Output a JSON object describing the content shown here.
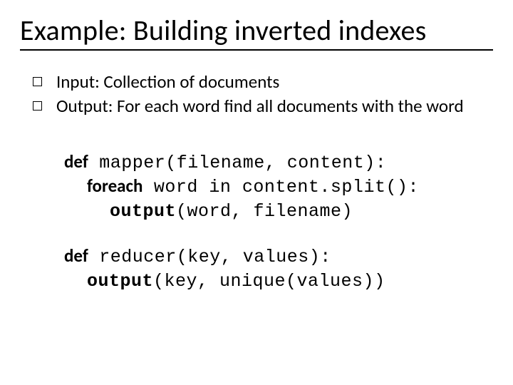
{
  "title": "Example: Building inverted indexes",
  "bullets": [
    "Input: Collection of documents",
    "Output: For each word find all documents with the word"
  ],
  "code": {
    "mapper": {
      "def_kw": "def",
      "sig": " mapper(filename, content):",
      "foreach_kw": "foreach",
      "foreach_rest": "  word  in content.split():",
      "output_kw": "output",
      "output_rest": "(word, filename)"
    },
    "reducer": {
      "def_kw": "def",
      "sig": " reducer(key, values):",
      "output_kw": "output",
      "output_rest": "(key, unique(values))"
    }
  }
}
